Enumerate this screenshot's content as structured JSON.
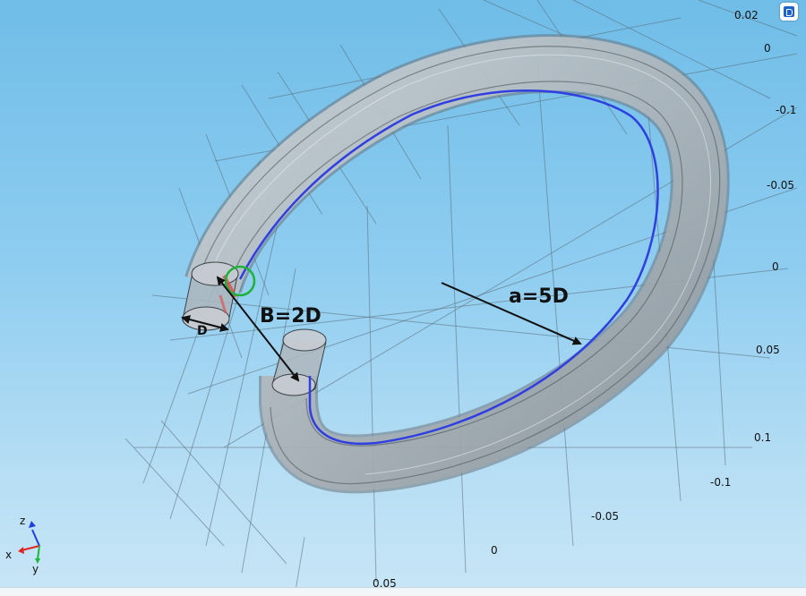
{
  "app": {
    "logo": "comsol-logo-icon"
  },
  "annotations": {
    "radius_label": "a=5D",
    "gap_label": "B=2D",
    "diameter_label": "D"
  },
  "axis_ticks": {
    "right": [
      "0.02",
      "0",
      "-0.1",
      "-0.05",
      "0",
      "0.05",
      "0.1"
    ],
    "bottom_right": [
      "-0.1",
      "-0.05",
      "0"
    ],
    "bottom": [
      "0.05"
    ]
  },
  "triad": {
    "z": "z",
    "x": "x",
    "y": "y"
  },
  "colors": {
    "background_top": "#6fbde8",
    "background_bottom": "#c8e6f6",
    "tube_fill": "#b9c0c6",
    "centerline": "#2f3fe0",
    "inlet_highlight": "#e04848",
    "marker_circle": "#1db33a"
  }
}
